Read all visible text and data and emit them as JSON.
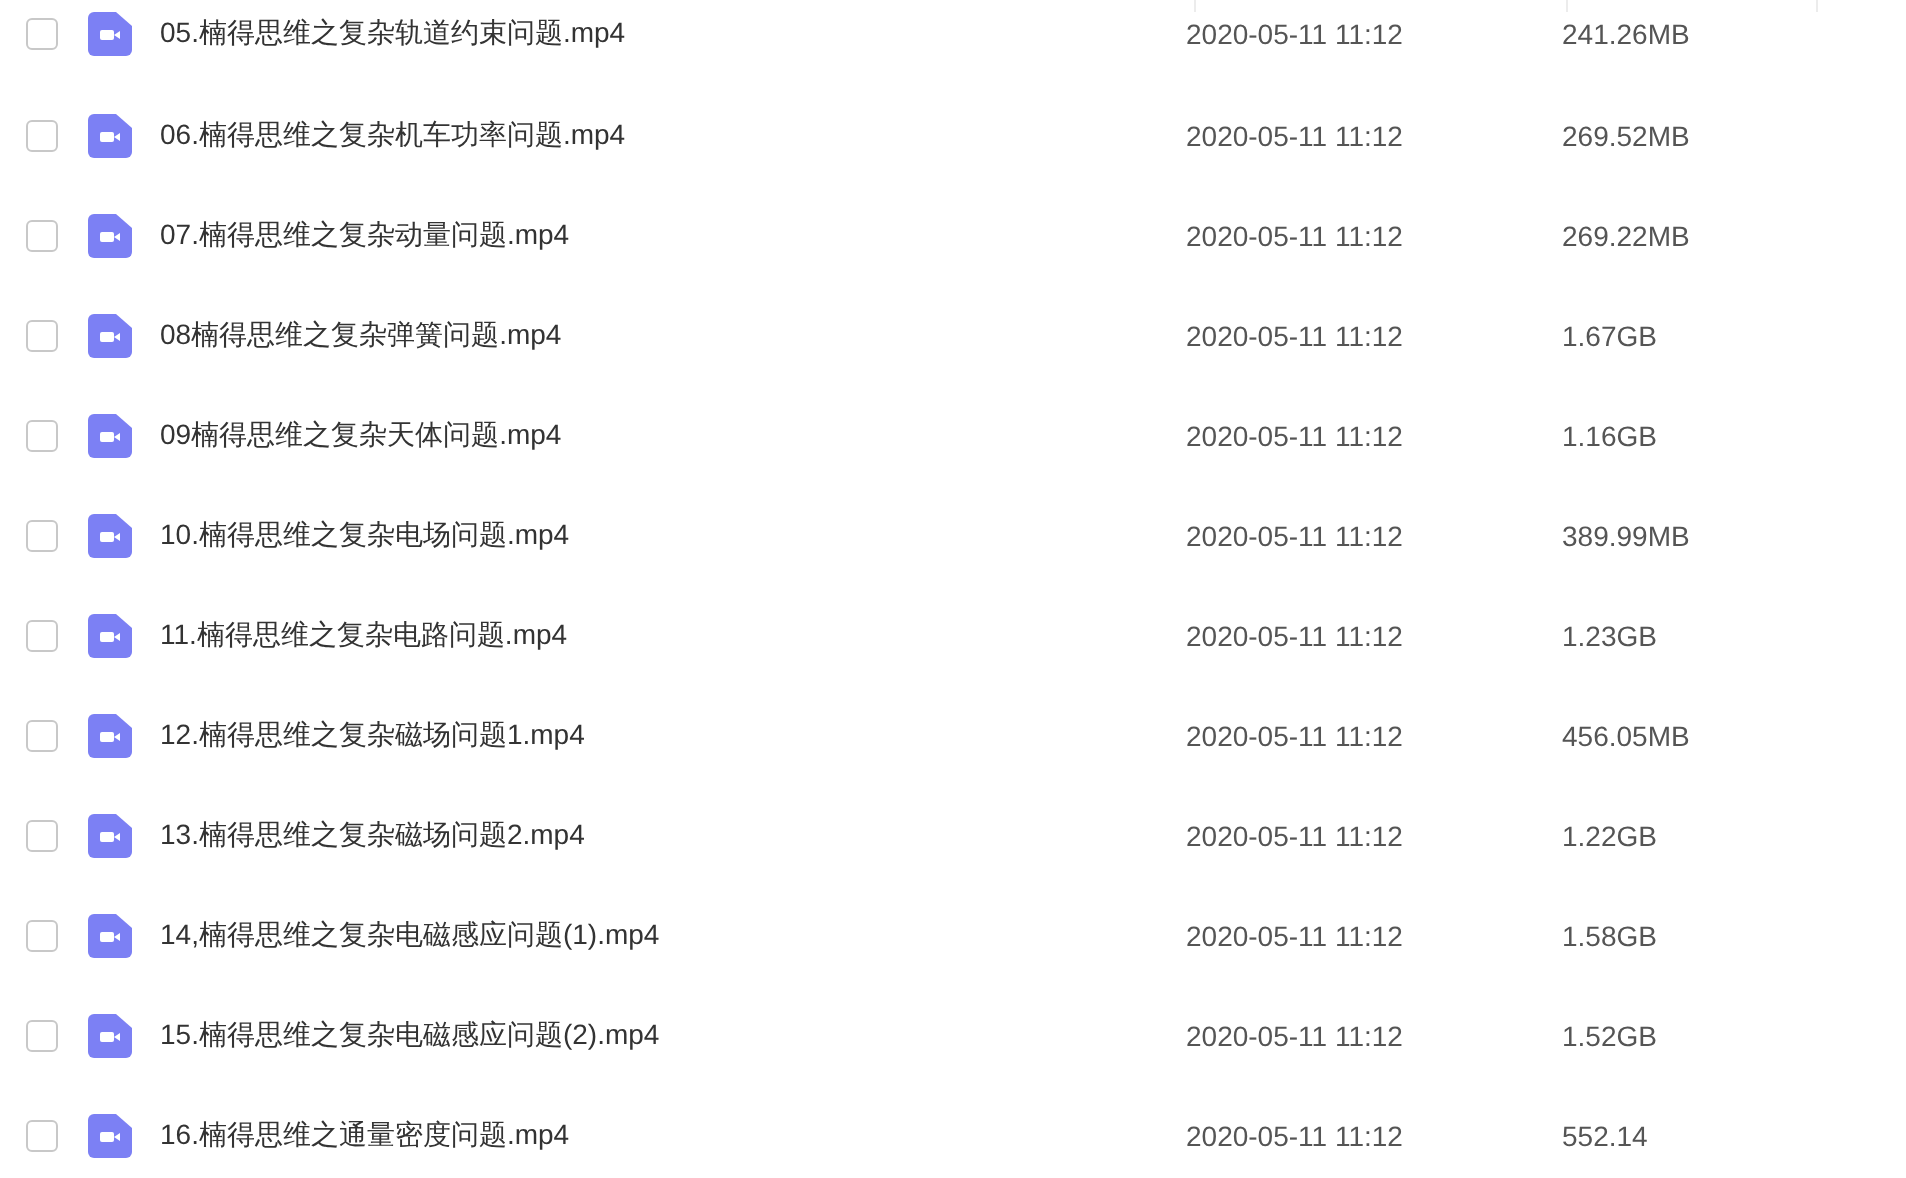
{
  "files": [
    {
      "name": "05.楠得思维之复杂轨道约束问题.mp4",
      "modified": "2020-05-11 11:12",
      "size": "241.26MB",
      "kind": "video",
      "checked": false
    },
    {
      "name": "06.楠得思维之复杂机车功率问题.mp4",
      "modified": "2020-05-11 11:12",
      "size": "269.52MB",
      "kind": "video",
      "checked": false
    },
    {
      "name": "07.楠得思维之复杂动量问题.mp4",
      "modified": "2020-05-11 11:12",
      "size": "269.22MB",
      "kind": "video",
      "checked": false
    },
    {
      "name": "08楠得思维之复杂弹簧问题.mp4",
      "modified": "2020-05-11 11:12",
      "size": "1.67GB",
      "kind": "video",
      "checked": false
    },
    {
      "name": "09楠得思维之复杂天体问题.mp4",
      "modified": "2020-05-11 11:12",
      "size": "1.16GB",
      "kind": "video",
      "checked": false
    },
    {
      "name": "10.楠得思维之复杂电场问题.mp4",
      "modified": "2020-05-11 11:12",
      "size": "389.99MB",
      "kind": "video",
      "checked": false
    },
    {
      "name": "11.楠得思维之复杂电路问题.mp4",
      "modified": "2020-05-11 11:12",
      "size": "1.23GB",
      "kind": "video",
      "checked": false
    },
    {
      "name": "12.楠得思维之复杂磁场问题1.mp4",
      "modified": "2020-05-11 11:12",
      "size": "456.05MB",
      "kind": "video",
      "checked": false
    },
    {
      "name": "13.楠得思维之复杂磁场问题2.mp4",
      "modified": "2020-05-11 11:12",
      "size": "1.22GB",
      "kind": "video",
      "checked": false
    },
    {
      "name": "14,楠得思维之复杂电磁感应问题(1).mp4",
      "modified": "2020-05-11 11:12",
      "size": "1.58GB",
      "kind": "video",
      "checked": false
    },
    {
      "name": "15.楠得思维之复杂电磁感应问题(2).mp4",
      "modified": "2020-05-11 11:12",
      "size": "1.52GB",
      "kind": "video",
      "checked": false
    },
    {
      "name": "16.楠得思维之通量密度问题.mp4",
      "modified": "2020-05-11 11:12",
      "size": "552.14",
      "kind": "video",
      "checked": false
    }
  ]
}
